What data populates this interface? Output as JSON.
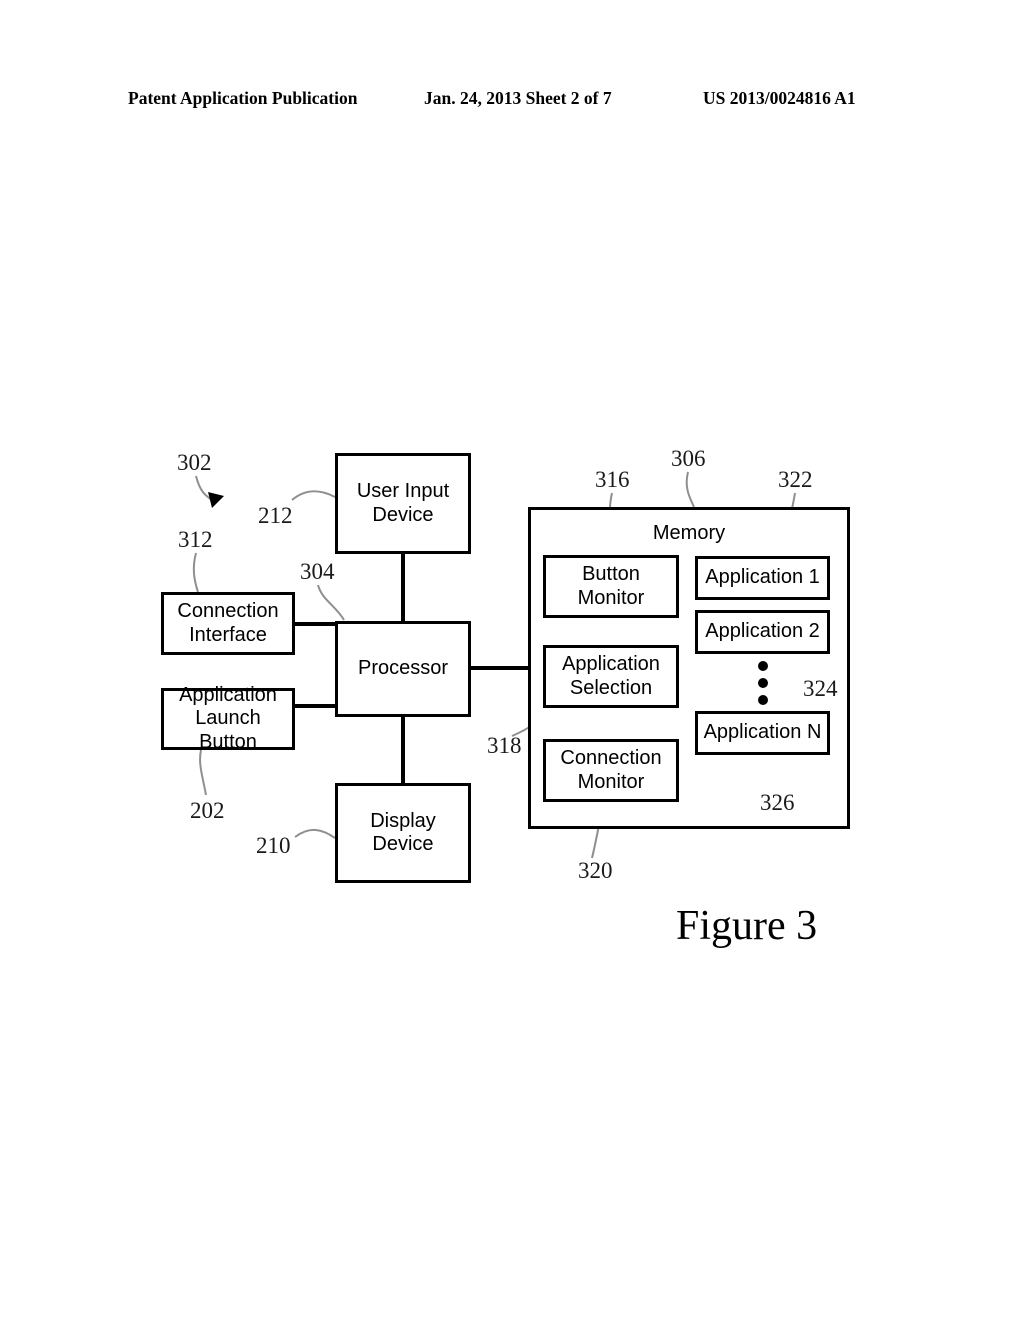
{
  "header": {
    "left": "Patent Application Publication",
    "middle": "Jan. 24, 2013  Sheet 2 of 7",
    "right": "US 2013/0024816 A1"
  },
  "figure": {
    "caption": "Figure 3",
    "system_ref": "302"
  },
  "blocks": {
    "user_input_device": "User Input\nDevice",
    "connection_interface": "Connection\nInterface",
    "application_launch_button": "Application\nLaunch Button",
    "processor": "Processor",
    "display_device": "Display\nDevice",
    "memory_title": "Memory",
    "button_monitor": "Button\nMonitor",
    "application_selection": "Application\nSelection",
    "connection_monitor": "Connection\nMonitor",
    "application_1": "Application 1",
    "application_2": "Application 2",
    "application_n": "Application N"
  },
  "refs": {
    "system": "302",
    "user_input_device": "212",
    "connection_interface": "312",
    "processor": "304",
    "application_launch_button": "202",
    "display_device": "210",
    "memory": "306",
    "button_monitor": "316",
    "application_selection": "318",
    "connection_monitor": "320",
    "application_1": "322",
    "applications_group": "324",
    "application_n": "326"
  },
  "colors": {
    "ink": "#000000",
    "paper": "#ffffff",
    "lead_line": "#8a8a8a"
  }
}
